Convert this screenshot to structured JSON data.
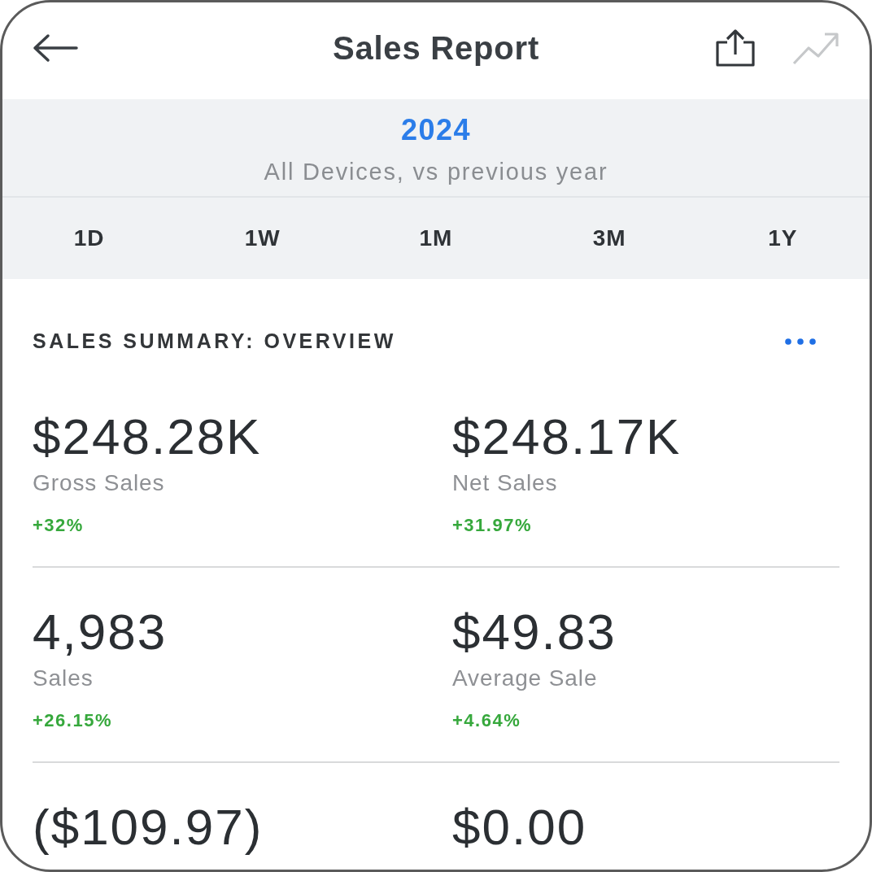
{
  "top_bar": {
    "title": "Sales Report",
    "actions": [
      {
        "kind": "share",
        "disabled": false
      },
      {
        "kind": "trend",
        "disabled": true
      }
    ]
  },
  "period": {
    "year": "2024",
    "subtitle": "All Devices, vs previous year"
  },
  "ranges": [
    "1D",
    "1W",
    "1M",
    "3M",
    "1Y"
  ],
  "summary": {
    "title": "SALES SUMMARY: OVERVIEW",
    "metrics": [
      {
        "value": "$248.28K",
        "label": "Gross Sales",
        "change": "+32%"
      },
      {
        "value": "$248.17K",
        "label": "Net Sales",
        "change": "+31.97%"
      },
      {
        "value": "4,983",
        "label": "Sales",
        "change": "+26.15%"
      },
      {
        "value": "$49.83",
        "label": "Average Sale",
        "change": "+4.64%"
      },
      {
        "value": "($109.97)"
      },
      {
        "value": "$0.00"
      }
    ]
  }
}
